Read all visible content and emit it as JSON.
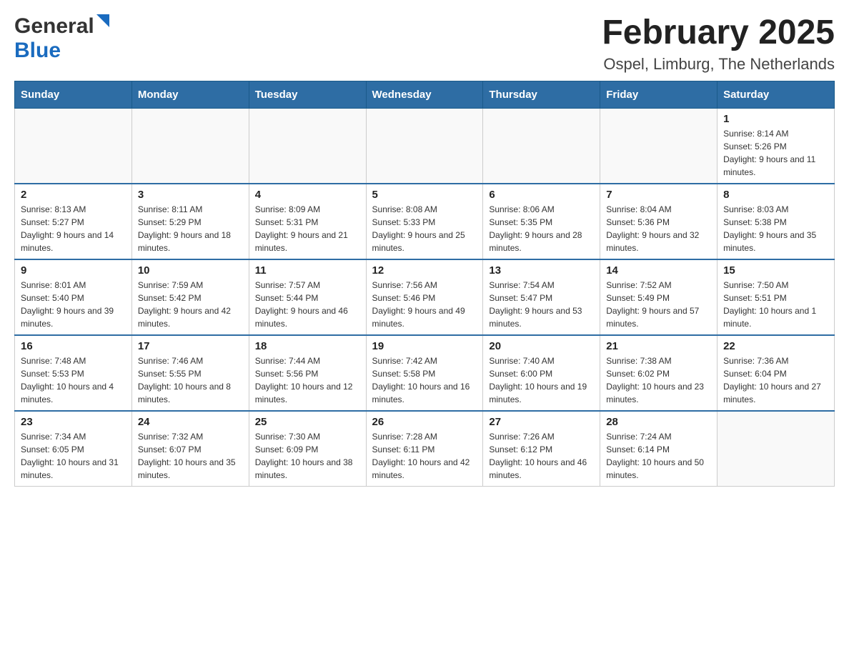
{
  "header": {
    "logo_general": "General",
    "logo_blue": "Blue",
    "month_title": "February 2025",
    "location": "Ospel, Limburg, The Netherlands"
  },
  "days_of_week": [
    "Sunday",
    "Monday",
    "Tuesday",
    "Wednesday",
    "Thursday",
    "Friday",
    "Saturday"
  ],
  "weeks": [
    [
      {
        "day": "",
        "info": ""
      },
      {
        "day": "",
        "info": ""
      },
      {
        "day": "",
        "info": ""
      },
      {
        "day": "",
        "info": ""
      },
      {
        "day": "",
        "info": ""
      },
      {
        "day": "",
        "info": ""
      },
      {
        "day": "1",
        "info": "Sunrise: 8:14 AM\nSunset: 5:26 PM\nDaylight: 9 hours and 11 minutes."
      }
    ],
    [
      {
        "day": "2",
        "info": "Sunrise: 8:13 AM\nSunset: 5:27 PM\nDaylight: 9 hours and 14 minutes."
      },
      {
        "day": "3",
        "info": "Sunrise: 8:11 AM\nSunset: 5:29 PM\nDaylight: 9 hours and 18 minutes."
      },
      {
        "day": "4",
        "info": "Sunrise: 8:09 AM\nSunset: 5:31 PM\nDaylight: 9 hours and 21 minutes."
      },
      {
        "day": "5",
        "info": "Sunrise: 8:08 AM\nSunset: 5:33 PM\nDaylight: 9 hours and 25 minutes."
      },
      {
        "day": "6",
        "info": "Sunrise: 8:06 AM\nSunset: 5:35 PM\nDaylight: 9 hours and 28 minutes."
      },
      {
        "day": "7",
        "info": "Sunrise: 8:04 AM\nSunset: 5:36 PM\nDaylight: 9 hours and 32 minutes."
      },
      {
        "day": "8",
        "info": "Sunrise: 8:03 AM\nSunset: 5:38 PM\nDaylight: 9 hours and 35 minutes."
      }
    ],
    [
      {
        "day": "9",
        "info": "Sunrise: 8:01 AM\nSunset: 5:40 PM\nDaylight: 9 hours and 39 minutes."
      },
      {
        "day": "10",
        "info": "Sunrise: 7:59 AM\nSunset: 5:42 PM\nDaylight: 9 hours and 42 minutes."
      },
      {
        "day": "11",
        "info": "Sunrise: 7:57 AM\nSunset: 5:44 PM\nDaylight: 9 hours and 46 minutes."
      },
      {
        "day": "12",
        "info": "Sunrise: 7:56 AM\nSunset: 5:46 PM\nDaylight: 9 hours and 49 minutes."
      },
      {
        "day": "13",
        "info": "Sunrise: 7:54 AM\nSunset: 5:47 PM\nDaylight: 9 hours and 53 minutes."
      },
      {
        "day": "14",
        "info": "Sunrise: 7:52 AM\nSunset: 5:49 PM\nDaylight: 9 hours and 57 minutes."
      },
      {
        "day": "15",
        "info": "Sunrise: 7:50 AM\nSunset: 5:51 PM\nDaylight: 10 hours and 1 minute."
      }
    ],
    [
      {
        "day": "16",
        "info": "Sunrise: 7:48 AM\nSunset: 5:53 PM\nDaylight: 10 hours and 4 minutes."
      },
      {
        "day": "17",
        "info": "Sunrise: 7:46 AM\nSunset: 5:55 PM\nDaylight: 10 hours and 8 minutes."
      },
      {
        "day": "18",
        "info": "Sunrise: 7:44 AM\nSunset: 5:56 PM\nDaylight: 10 hours and 12 minutes."
      },
      {
        "day": "19",
        "info": "Sunrise: 7:42 AM\nSunset: 5:58 PM\nDaylight: 10 hours and 16 minutes."
      },
      {
        "day": "20",
        "info": "Sunrise: 7:40 AM\nSunset: 6:00 PM\nDaylight: 10 hours and 19 minutes."
      },
      {
        "day": "21",
        "info": "Sunrise: 7:38 AM\nSunset: 6:02 PM\nDaylight: 10 hours and 23 minutes."
      },
      {
        "day": "22",
        "info": "Sunrise: 7:36 AM\nSunset: 6:04 PM\nDaylight: 10 hours and 27 minutes."
      }
    ],
    [
      {
        "day": "23",
        "info": "Sunrise: 7:34 AM\nSunset: 6:05 PM\nDaylight: 10 hours and 31 minutes."
      },
      {
        "day": "24",
        "info": "Sunrise: 7:32 AM\nSunset: 6:07 PM\nDaylight: 10 hours and 35 minutes."
      },
      {
        "day": "25",
        "info": "Sunrise: 7:30 AM\nSunset: 6:09 PM\nDaylight: 10 hours and 38 minutes."
      },
      {
        "day": "26",
        "info": "Sunrise: 7:28 AM\nSunset: 6:11 PM\nDaylight: 10 hours and 42 minutes."
      },
      {
        "day": "27",
        "info": "Sunrise: 7:26 AM\nSunset: 6:12 PM\nDaylight: 10 hours and 46 minutes."
      },
      {
        "day": "28",
        "info": "Sunrise: 7:24 AM\nSunset: 6:14 PM\nDaylight: 10 hours and 50 minutes."
      },
      {
        "day": "",
        "info": ""
      }
    ]
  ]
}
